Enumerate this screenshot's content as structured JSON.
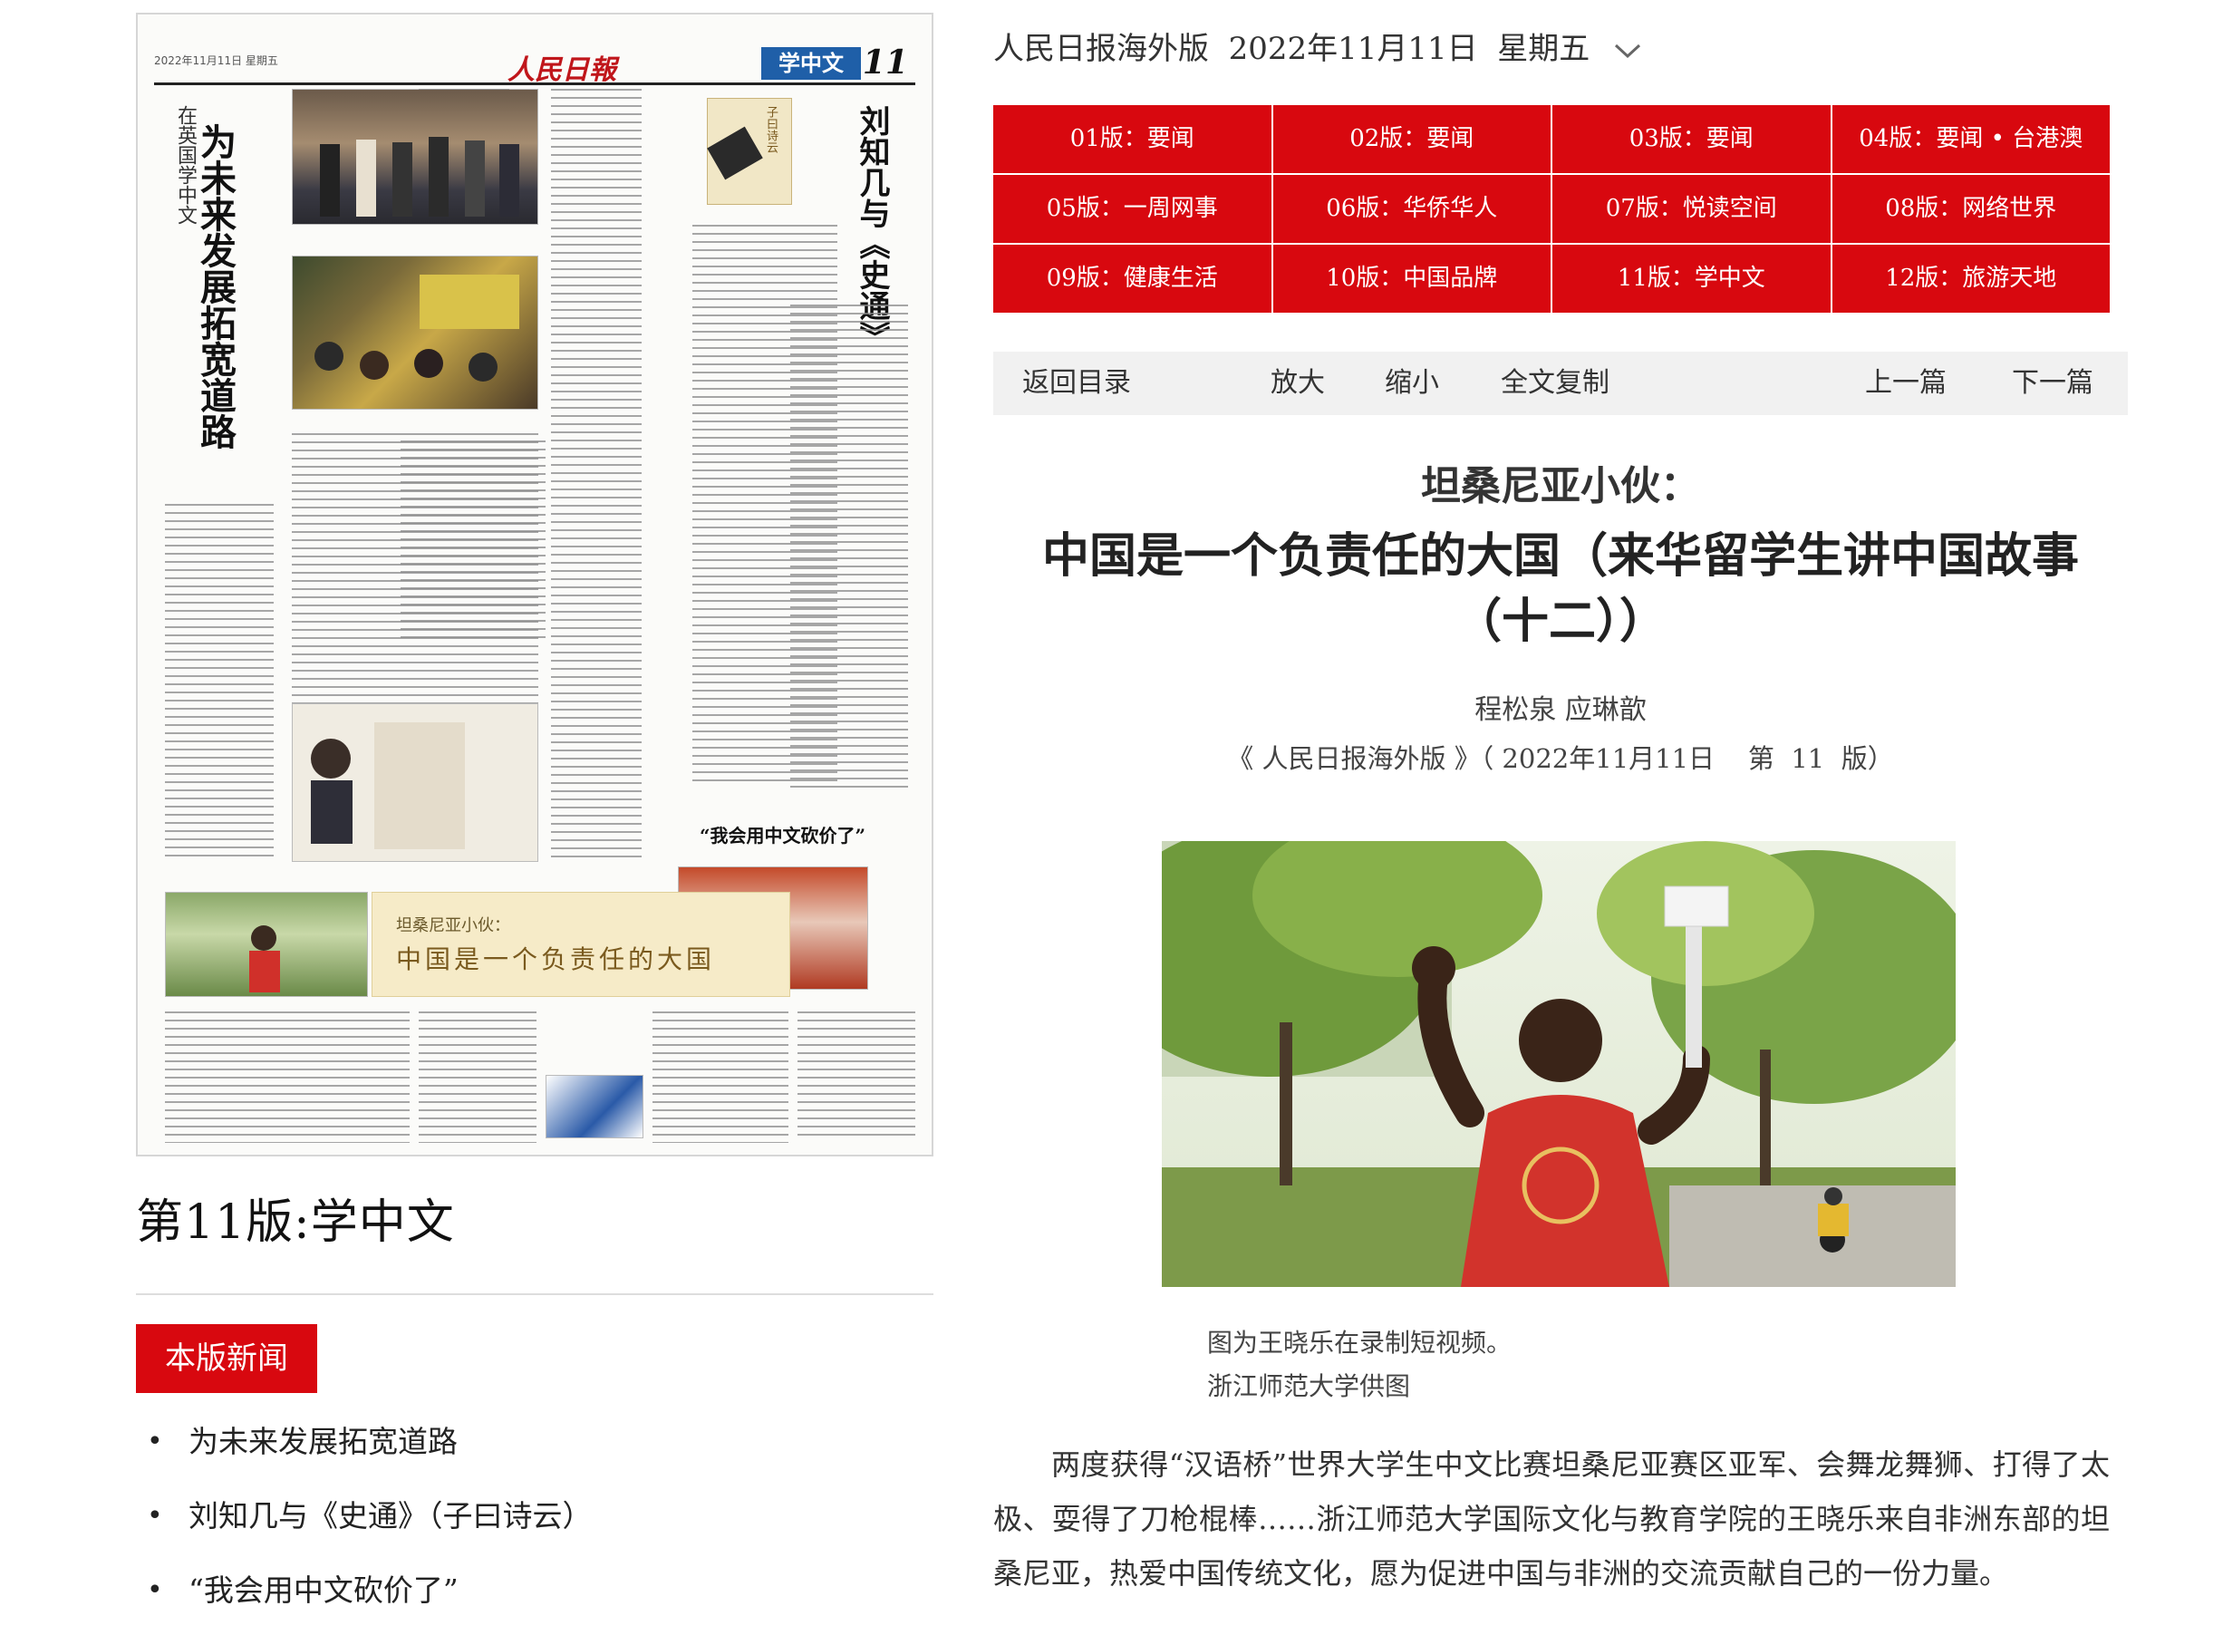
{
  "newspaper_page": {
    "masthead_logo": "人民日報",
    "section_label": "学中文",
    "page_number": "11",
    "date_line": "2022年11月11日 星期五",
    "story1_kicker": "在英国学中文",
    "story1_headline": "为未来发展拓宽道路",
    "story2_headline": "刘知几与《史通》",
    "card_label": "子曰诗云",
    "story3_headline": "“我会用中文砍价了”",
    "banner_sub": "坦桑尼亚小伙：",
    "banner_main": "中国是一个负责任的大国"
  },
  "edition_label": "第11版:学中文",
  "news_section": {
    "tag": "本版新闻",
    "items": [
      "为未来发展拓宽道路",
      "刘知几与《史通》（子曰诗云）",
      "“我会用中文砍价了”"
    ]
  },
  "date_header": "人民日报海外版  2022年11月11日  星期五",
  "editions": [
    "01版：要闻",
    "02版：要闻",
    "03版：要闻",
    "04版：要闻 • 台港澳",
    "05版：一周网事",
    "06版：华侨华人",
    "07版：悦读空间",
    "08版：网络世界",
    "09版：健康生活",
    "10版：中国品牌",
    "11版：学中文",
    "12版：旅游天地"
  ],
  "toolbar": {
    "back": "返回目录",
    "zoom_in": "放大",
    "zoom_out": "缩小",
    "copy_all": "全文复制",
    "prev": "上一篇",
    "next": "下一篇"
  },
  "article": {
    "pretitle": "坦桑尼亚小伙：",
    "title": "中国是一个负责任的大国（来华留学生讲中国故事（十二））",
    "authors": "程松泉 应琳歆",
    "source": "《 人民日报海外版 》（ 2022年11月11日    第  11  版）",
    "caption_line1": "图为王晓乐在录制短视频。",
    "caption_line2": "浙江师范大学供图",
    "body": "两度获得“汉语桥”世界大学生中文比赛坦桑尼亚赛区亚军、会舞龙舞狮、打得了太极、耍得了刀枪棍棒……浙江师范大学国际文化与教育学院的王晓乐来自非洲东部的坦桑尼亚，热爱中国传统文化，愿为促进中国与非洲的交流贡献自己的一份力量。"
  },
  "colors": {
    "accent_red": "#d8080f",
    "toolbar_bg": "#f1f1f1",
    "section_blue": "#1f5fa8"
  }
}
